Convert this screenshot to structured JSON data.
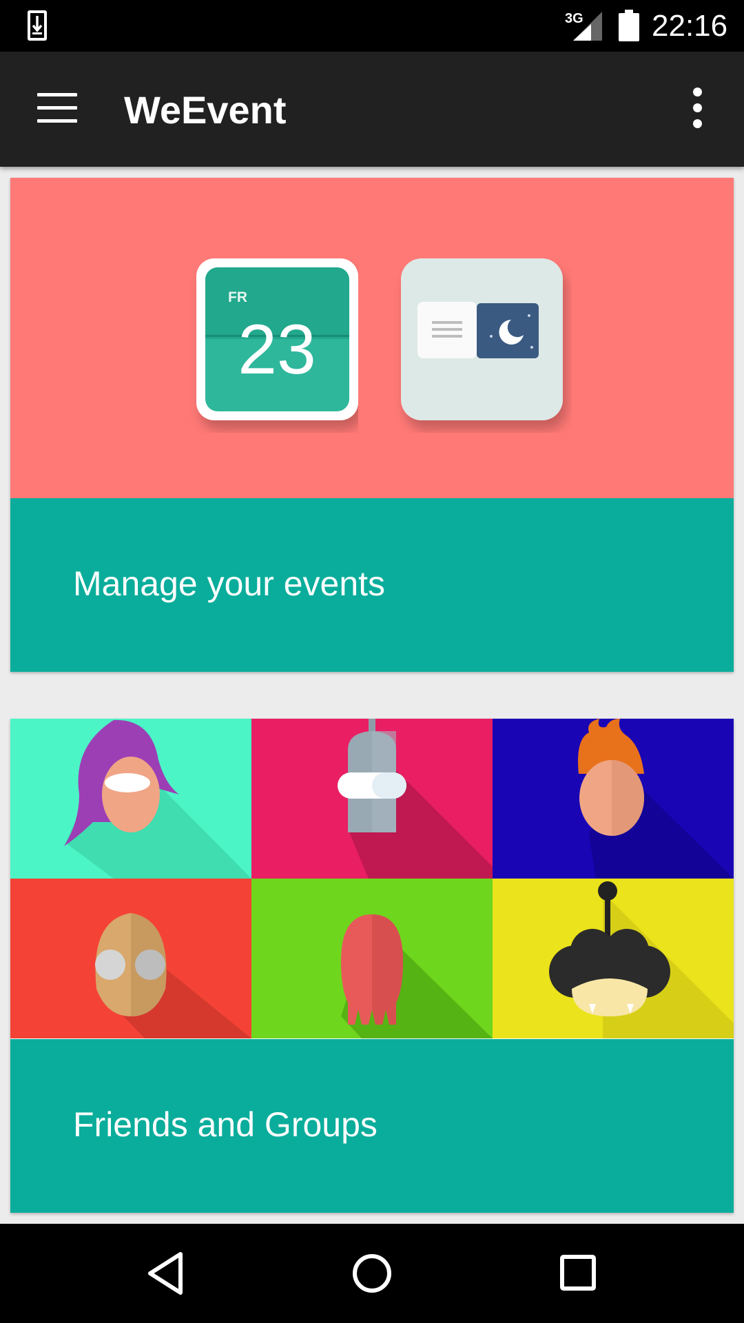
{
  "status_bar": {
    "time": "22:16",
    "network_label": "3G",
    "icons": [
      "download-icon",
      "signal-icon",
      "battery-icon"
    ]
  },
  "app_bar": {
    "title": "WeEvent",
    "menu_icon": "hamburger-menu-icon",
    "overflow_icon": "more-vertical-icon"
  },
  "cards": {
    "events": {
      "label": "Manage your events",
      "calendar_day": "FR",
      "calendar_date": "23"
    },
    "friends": {
      "label": "Friends and Groups"
    }
  },
  "colors": {
    "accent": "#0aad9b",
    "events_background": "#ff7976",
    "app_bar": "#212121",
    "friend_tiles": [
      "#4cf5c6",
      "#e91e63",
      "#1a05b5",
      "#f44336",
      "#6fd61e",
      "#ebe31b"
    ]
  },
  "nav_bar": {
    "icons": [
      "back-icon",
      "home-icon",
      "recents-icon"
    ]
  }
}
